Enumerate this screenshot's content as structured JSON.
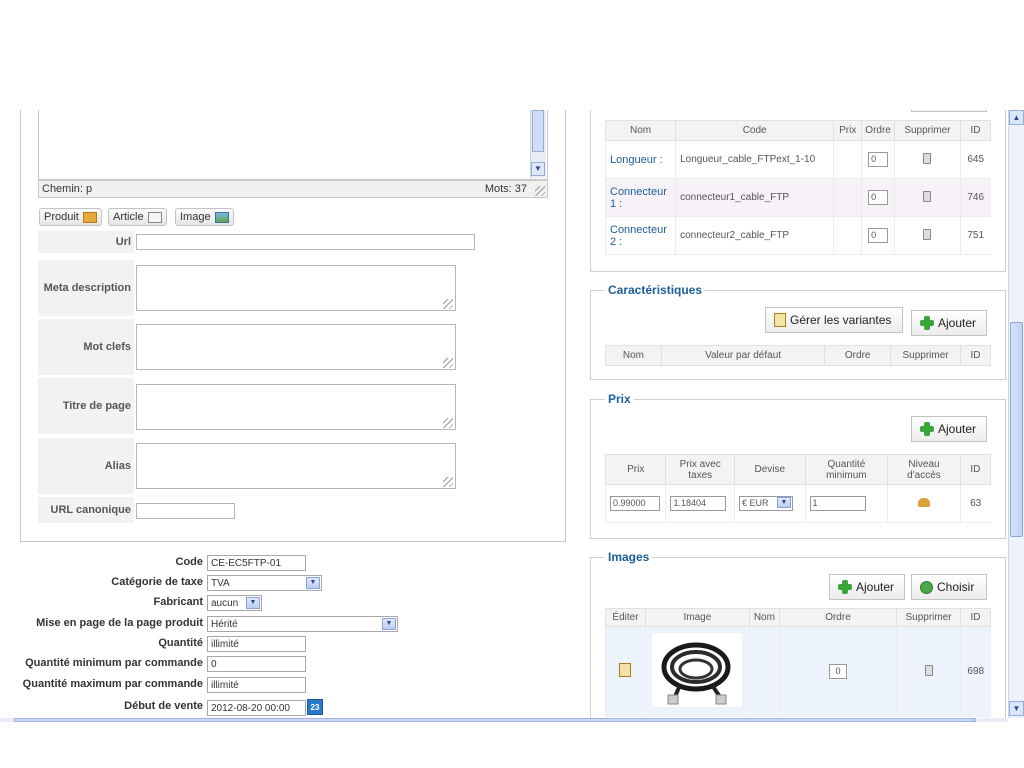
{
  "editor": {
    "path_label": "Chemin: p",
    "word_count": "Mots: 37",
    "toolbar": [
      {
        "label": "Produit",
        "icon": "product-icon"
      },
      {
        "label": "Article",
        "icon": "article-icon"
      },
      {
        "label": "Image",
        "icon": "image-icon"
      }
    ]
  },
  "meta_fields": [
    {
      "label": "Url",
      "type": "input"
    },
    {
      "label": "Meta description",
      "type": "textarea"
    },
    {
      "label": "Mot clefs",
      "type": "textarea"
    },
    {
      "label": "Titre de page",
      "type": "textarea"
    },
    {
      "label": "Alias",
      "type": "textarea"
    },
    {
      "label": "URL canonique",
      "type": "input"
    }
  ],
  "product_form": {
    "code": {
      "label": "Code",
      "value": "CE-EC5FTP-01"
    },
    "tax_category": {
      "label": "Catégorie de taxe",
      "value": "TVA"
    },
    "manufacturer": {
      "label": "Fabricant",
      "value": "aucun"
    },
    "layout": {
      "label": "Mise en page de la page produit",
      "value": "Hérité"
    },
    "quantity": {
      "label": "Quantité",
      "value": "illimité"
    },
    "min_qty": {
      "label": "Quantité minimum par commande",
      "value": "0"
    },
    "max_qty": {
      "label": "Quantité maximum par commande",
      "value": "illimité"
    },
    "sale_start": {
      "label": "Début de vente",
      "value": "2012-08-20 00:00",
      "calendar_day": "23"
    }
  },
  "variants_table": {
    "headers": [
      "Nom",
      "Code",
      "Prix",
      "Ordre",
      "Supprimer",
      "ID"
    ],
    "rows": [
      {
        "name": "Longueur :",
        "code": "Longueur_cable_FTPext_1-10",
        "price": "",
        "order": "0",
        "id": "645"
      },
      {
        "name": "Connecteur 1 :",
        "code": "connecteur1_cable_FTP",
        "price": "",
        "order": "0",
        "id": "746"
      },
      {
        "name": "Connecteur 2 :",
        "code": "connecteur2_cable_FTP",
        "price": "",
        "order": "0",
        "id": "751"
      }
    ]
  },
  "characteristics": {
    "title": "Caractéristiques",
    "manage_label": "Gérer les variantes",
    "add_label": "Ajouter",
    "headers": [
      "Nom",
      "Valeur par défaut",
      "Ordre",
      "Supprimer",
      "ID"
    ]
  },
  "prices": {
    "title": "Prix",
    "add_label": "Ajouter",
    "headers": [
      "Prix",
      "Prix avec taxes",
      "Devise",
      "Quantité minimum",
      "Niveau d'accès",
      "ID"
    ],
    "row": {
      "price": "0.99000",
      "price_tax": "1.18404",
      "currency": "€ EUR",
      "min_qty": "1",
      "id": "63"
    }
  },
  "images": {
    "title": "Images",
    "add_label": "Ajouter",
    "choose_label": "Choisir",
    "headers": [
      "Éditer",
      "Image",
      "Nom",
      "Ordre",
      "Supprimer",
      "ID"
    ],
    "row": {
      "name": "",
      "order": "0",
      "id": "698"
    }
  },
  "colors": {
    "accent": "#1d5e9c",
    "add_green": "#3aa53a",
    "header_bg": "#f3f3f3"
  }
}
